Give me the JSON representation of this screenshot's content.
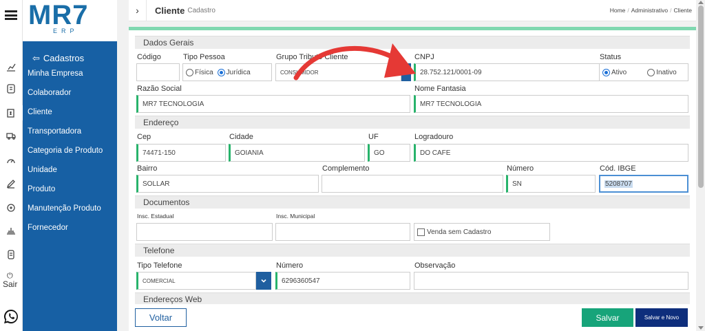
{
  "logo": {
    "text": "MR7",
    "sub": "ERP"
  },
  "rail": {
    "exit_label": "Sair"
  },
  "sidebar": {
    "header": "Cadastros",
    "items": [
      {
        "label": "Minha Empresa"
      },
      {
        "label": "Colaborador"
      },
      {
        "label": "Cliente"
      },
      {
        "label": "Transportadora"
      },
      {
        "label": "Categoria de Produto"
      },
      {
        "label": "Unidade"
      },
      {
        "label": "Produto"
      },
      {
        "label": "Manutenção Produto"
      },
      {
        "label": "Fornecedor"
      }
    ]
  },
  "topbar": {
    "title": "Cliente",
    "subtitle": "Cadastro",
    "breadcrumb": [
      "Home",
      "Administrativo",
      "Cliente"
    ]
  },
  "sections": {
    "dados_gerais": "Dados Gerais",
    "endereco": "Endereço",
    "documentos": "Documentos",
    "telefone": "Telefone",
    "enderecos_web": "Endereços Web"
  },
  "form": {
    "codigo": {
      "label": "Código",
      "value": ""
    },
    "tipo_pessoa": {
      "label": "Tipo Pessoa",
      "options": [
        "Física",
        "Jurídica"
      ],
      "selected": "Jurídica"
    },
    "grupo_tributo": {
      "label": "Grupo Tributo Cliente",
      "value": "CONSUMIDOR"
    },
    "cnpj": {
      "label": "CNPJ",
      "value": "28.752.121/0001-09"
    },
    "status": {
      "label": "Status",
      "options": [
        "Ativo",
        "Inativo"
      ],
      "selected": "Ativo"
    },
    "razao_social": {
      "label": "Razão Social",
      "value": "MR7 TECNOLOGIA"
    },
    "nome_fantasia": {
      "label": "Nome Fantasia",
      "value": "MR7 TECNOLOGIA"
    },
    "cep": {
      "label": "Cep",
      "value": "74471-150"
    },
    "cidade": {
      "label": "Cidade",
      "value": "GOIANIA"
    },
    "uf": {
      "label": "UF",
      "value": "GO"
    },
    "logradouro": {
      "label": "Logradouro",
      "value": "DO CAFE"
    },
    "bairro": {
      "label": "Bairro",
      "value": "SOLLAR"
    },
    "complemento": {
      "label": "Complemento",
      "value": ""
    },
    "numero": {
      "label": "Número",
      "value": "SN"
    },
    "cod_ibge": {
      "label": "Cód. IBGE",
      "value": "5208707"
    },
    "insc_estadual": {
      "label": "Insc. Estadual",
      "value": ""
    },
    "insc_municipal": {
      "label": "Insc. Municipal",
      "value": ""
    },
    "venda_sem_cadastro": {
      "label": "Venda sem Cadastro",
      "checked": false
    },
    "tipo_telefone": {
      "label": "Tipo Telefone",
      "value": "COMERCIAL"
    },
    "numero_tel": {
      "label": "Número",
      "value": "6296360547"
    },
    "observacao": {
      "label": "Observação",
      "value": ""
    }
  },
  "buttons": {
    "voltar": "Voltar",
    "salvar": "Salvar",
    "salvar_novo": "Salvar e Novo"
  },
  "colors": {
    "sidebar": "#1760a4",
    "accent_green": "#17a47a",
    "navy": "#0e2e7c",
    "annotation_red": "#e53935"
  }
}
